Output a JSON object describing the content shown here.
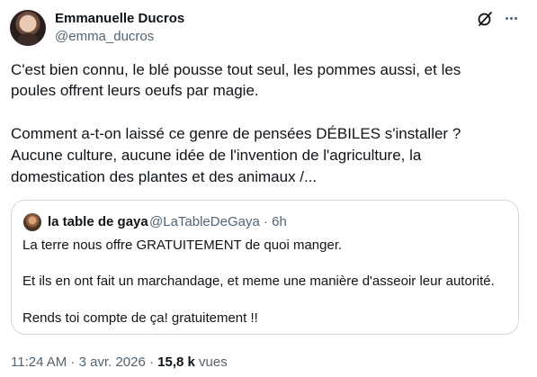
{
  "author": {
    "name": "Emmanuelle Ducros",
    "handle": "@emma_ducros"
  },
  "tweet": {
    "lines": [
      "C'est bien connu, le blé pousse tout seul, les pommes aussi, et les",
      "poules offrent leurs oeufs par magie.",
      "Comment a-t-on laissé ce genre de pensées DÉBILES s'installer ?",
      "Aucune culture, aucune idée de l'invention de l'agriculture, la",
      "domestication des plantes et des animaux /..."
    ]
  },
  "quoted_tweet": {
    "name": "la table de gaya",
    "meta": "@LaTableDeGaya · 6h",
    "lines": [
      "La terre nous offre GRATUITEMENT  de quoi manger.",
      "Et ils en ont fait un marchandage, et meme une manière d'asseoir leur autorité.",
      "Rends toi compte de ça! gratuitement !!"
    ]
  },
  "footer": {
    "time_date": "11:24 AM · 3 avr. 2026 · ",
    "views_count": "15,8 k",
    "views_label": " vues"
  },
  "icons": {
    "grok": "grok-icon",
    "more": "more-icon"
  },
  "colors": {
    "text": "#0f1419",
    "secondary": "#536471",
    "border": "#cfd9de"
  }
}
